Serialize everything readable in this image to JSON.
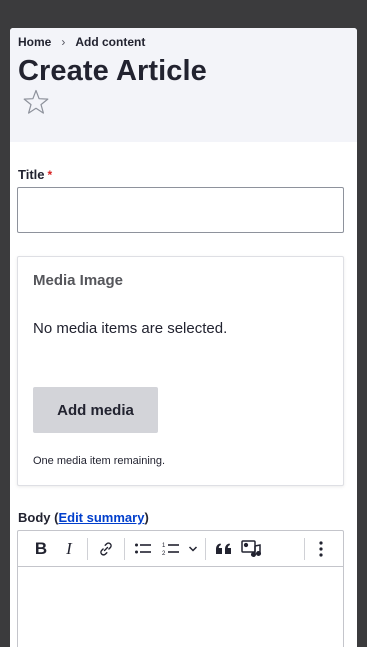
{
  "breadcrumb": {
    "items": [
      "Home",
      "Add content"
    ],
    "separator": "›"
  },
  "page": {
    "title": "Create Article",
    "favorite_icon": "star-outline-icon"
  },
  "form": {
    "title_field": {
      "label": "Title",
      "required_marker": "*",
      "value": "",
      "placeholder": ""
    },
    "media": {
      "heading": "Media Image",
      "empty_text": "No media items are selected.",
      "add_button": "Add media",
      "remaining_text": "One media item remaining."
    },
    "body": {
      "label_prefix": "Body (",
      "edit_summary_link": "Edit summary",
      "label_suffix": ")",
      "toolbar": {
        "bold": "B",
        "italic": "I",
        "buttons": [
          "bold-icon",
          "italic-icon",
          "link-icon",
          "bulleted-list-icon",
          "numbered-list-icon",
          "chevron-down-icon",
          "blockquote-icon",
          "insert-media-icon",
          "more-vertical-icon"
        ]
      },
      "content": ""
    }
  },
  "colors": {
    "header_bg": "#f3f4f9",
    "link": "#003ecc",
    "required": "#d72222",
    "button_bg": "#d3d4d9",
    "frame_bg": "#3b3b3d"
  }
}
